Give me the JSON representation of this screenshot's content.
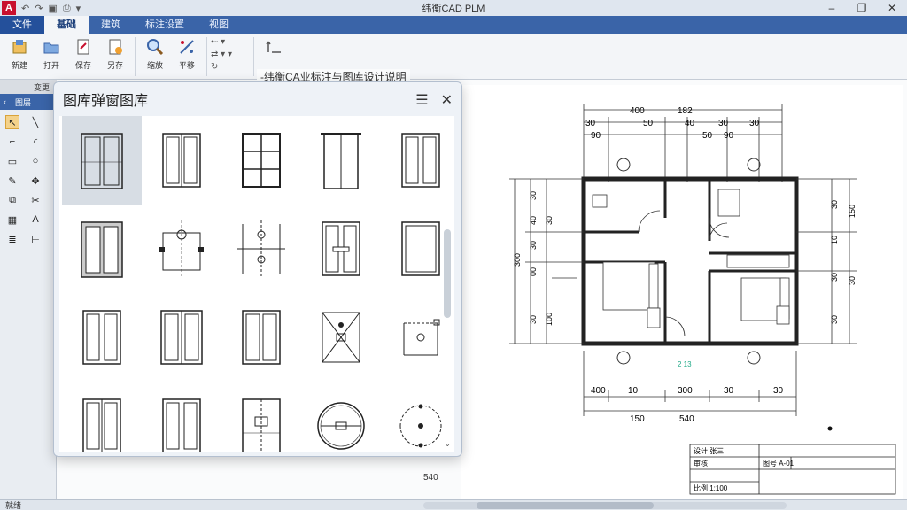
{
  "titlebar": {
    "title": "纬衡CAD PLM",
    "logo": "A",
    "minimize": "–",
    "restore": "❐",
    "close": "✕"
  },
  "tabs": [
    {
      "label": "文件",
      "state": "file"
    },
    {
      "label": "基础",
      "state": "active"
    },
    {
      "label": "建筑",
      "state": ""
    },
    {
      "label": "标注设置",
      "state": ""
    },
    {
      "label": "视图",
      "state": ""
    }
  ],
  "ribbon": {
    "buttons": [
      "新建",
      "打开",
      "保存",
      "另存",
      "缩放",
      "平移"
    ],
    "group_label": "变更"
  },
  "left_palette": {
    "header": "图层"
  },
  "document": {
    "tab_title": "-纬衡CA业标注与图库设计说明"
  },
  "dialog": {
    "title": "图库弹窗图库",
    "menu_icon": "☰",
    "close_icon": "✕"
  },
  "plan": {
    "dims_top": [
      "400",
      "182",
      "30",
      "50",
      "40",
      "30",
      "30",
      "90",
      "50",
      "90"
    ],
    "dims_bottom": [
      "400",
      "10",
      "300",
      "30",
      "30",
      "150",
      "540"
    ],
    "dims_left": [
      "30",
      "40",
      "30",
      "00",
      "30",
      "100",
      "30"
    ],
    "dims_right": [
      "30",
      "150",
      "10",
      "30",
      "30",
      "30"
    ],
    "dim_left_total": "300",
    "note": "2 13",
    "lower_dim": "540",
    "title_block": [
      "设计 张三",
      "审核",
      "图号 A-01",
      "比例 1:100"
    ]
  },
  "statusbar": {
    "left_text": "就绪"
  },
  "colors": {
    "ribbon_blue": "#3a64a8",
    "app_red": "#c8102e"
  }
}
